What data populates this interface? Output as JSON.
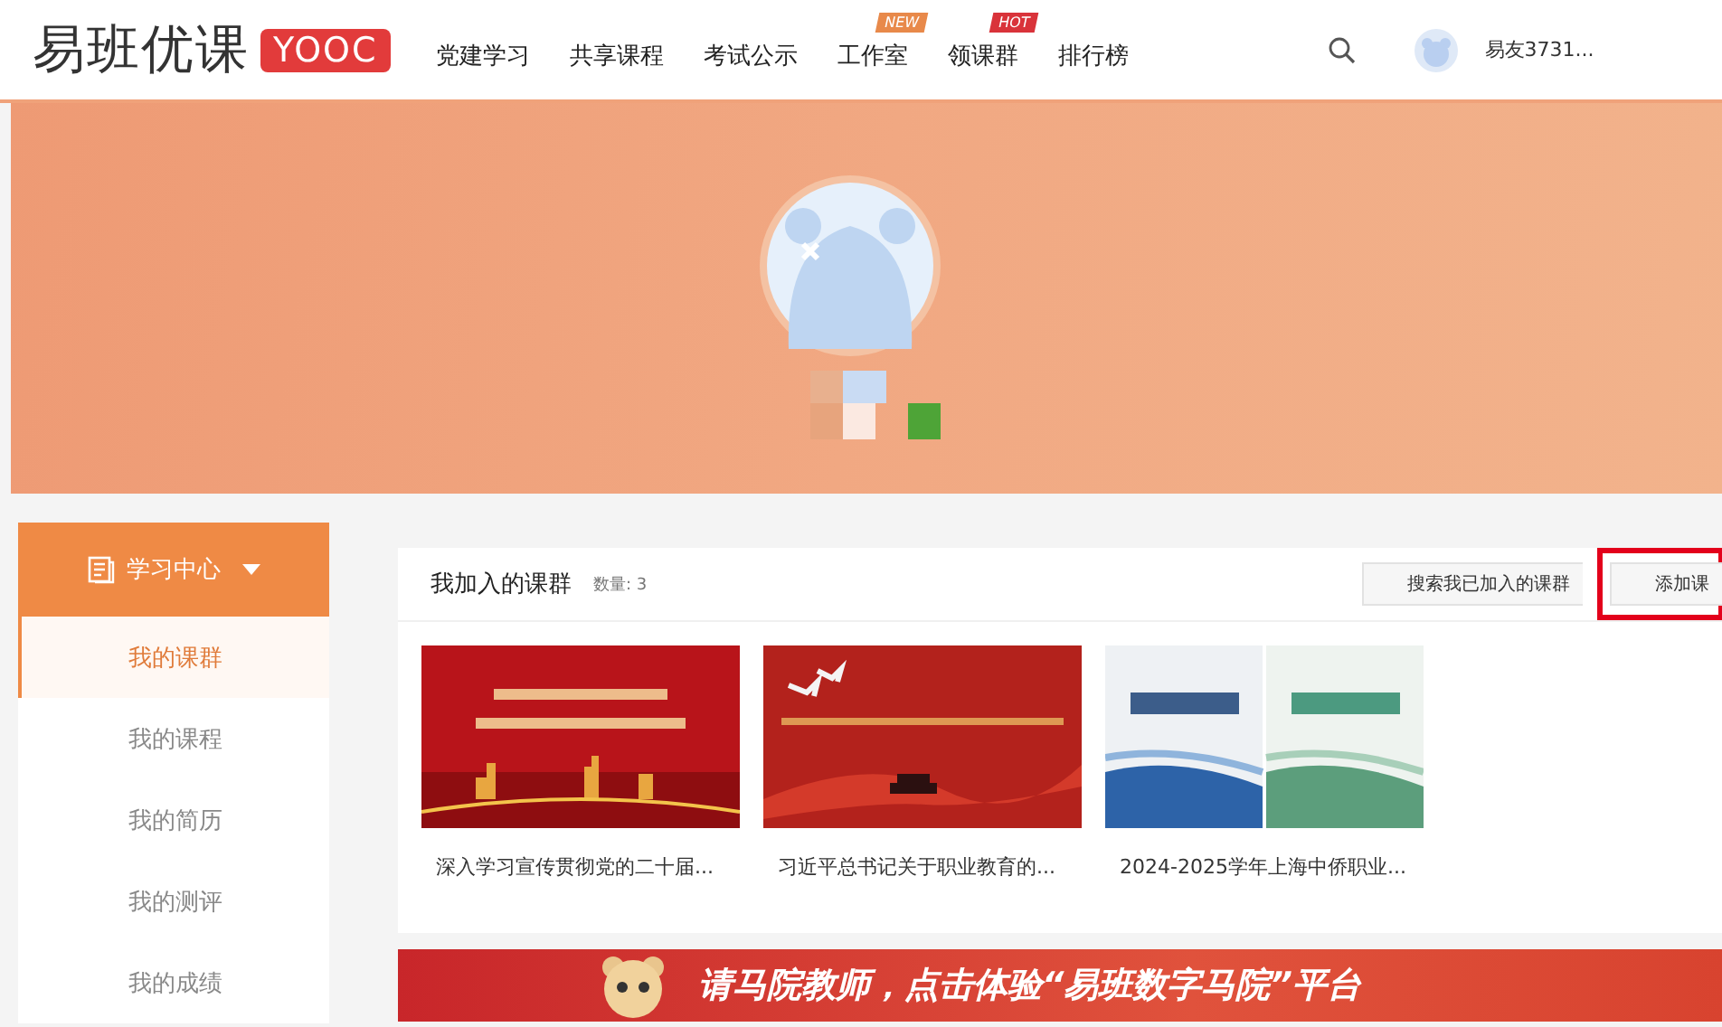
{
  "header": {
    "logo": "易班优课",
    "logo_badge": "YOOC",
    "nav": [
      {
        "label": "党建学习"
      },
      {
        "label": "共享课程"
      },
      {
        "label": "考试公示"
      },
      {
        "label": "工作室",
        "badge": {
          "text": "NEW",
          "color": "#e8894a"
        }
      },
      {
        "label": "领课群",
        "badge": {
          "text": "HOT",
          "color": "#d9333a"
        }
      },
      {
        "label": "排行榜"
      }
    ],
    "username": "易友3731..."
  },
  "sidebar": {
    "title": "学习中心",
    "items": [
      {
        "label": "我的课群",
        "selected": true
      },
      {
        "label": "我的课程",
        "selected": false
      },
      {
        "label": "我的简历",
        "selected": false
      },
      {
        "label": "我的测评",
        "selected": false
      },
      {
        "label": "我的成绩",
        "selected": false
      }
    ]
  },
  "groups": {
    "title": "我加入的课群",
    "count": "数量: 3",
    "buttons": [
      {
        "label": "搜索我已加入的课群",
        "highlighted": false
      },
      {
        "label": "添加课",
        "highlighted": true
      }
    ],
    "courses": [
      {
        "title": "深入学习宣传贯彻党的二十届...",
        "kind": "red-poster"
      },
      {
        "title": "习近平总书记关于职业教育的...",
        "kind": "ribbon-poster"
      },
      {
        "title": "2024-2025学年上海中侨职业...",
        "kind": "handbooks"
      }
    ]
  },
  "promo": {
    "text": "请马院教师，点击体验“易班数字马院”平台"
  }
}
